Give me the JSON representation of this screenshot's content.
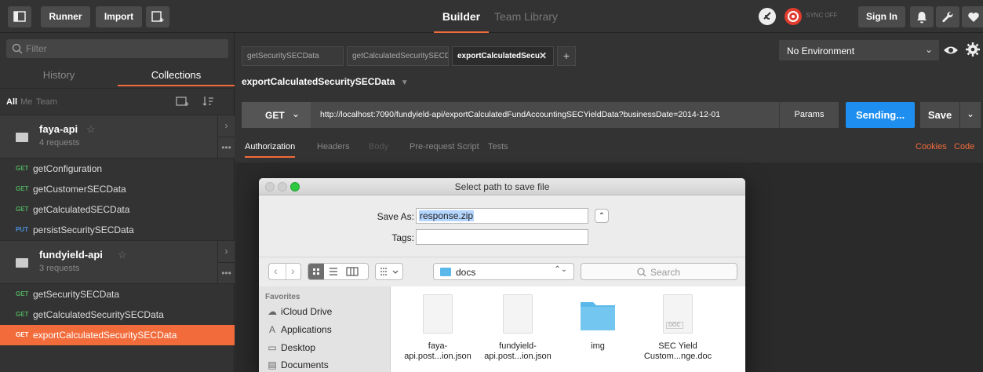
{
  "topbar": {
    "runner_label": "Runner",
    "import_label": "Import",
    "builder_tab": "Builder",
    "team_library_tab": "Team Library",
    "sync_status": "SYNC OFF",
    "signin_label": "Sign In"
  },
  "sidebar": {
    "filter_placeholder": "Filter",
    "history_tab": "History",
    "collections_tab": "Collections",
    "owner_all": "All",
    "owner_me": "Me",
    "owner_team": "Team",
    "collections": [
      {
        "name": "faya-api",
        "count": "4 requests",
        "requests": [
          {
            "method": "GET",
            "name": "getConfiguration"
          },
          {
            "method": "GET",
            "name": "getCustomerSECData"
          },
          {
            "method": "GET",
            "name": "getCalculatedSECData"
          },
          {
            "method": "PUT",
            "name": "persistSecuritySECData"
          }
        ]
      },
      {
        "name": "fundyield-api",
        "count": "3 requests",
        "requests": [
          {
            "method": "GET",
            "name": "getSecuritySECData"
          },
          {
            "method": "GET",
            "name": "getCalculatedSecuritySECData"
          },
          {
            "method": "GET",
            "name": "exportCalculatedSecuritySECData"
          }
        ]
      }
    ]
  },
  "main": {
    "tabs": [
      {
        "label": "getSecuritySECData"
      },
      {
        "label": "getCalculatedSecuritySECDa"
      },
      {
        "label": "exportCalculatedSecu"
      }
    ],
    "environment": "No Environment",
    "request_name": "exportCalculatedSecuritySECData",
    "method": "GET",
    "url": "http://localhost:7090/fundyield-api/exportCalculatedFundAccountingSECYieldData?businessDate=2014-12-01",
    "params_label": "Params",
    "send_label": "Sending...",
    "save_label": "Save",
    "subtabs": [
      "Authorization",
      "Headers",
      "Body",
      "Pre-request Script",
      "Tests"
    ],
    "cookies_label": "Cookies",
    "code_label": "Code"
  },
  "dialog": {
    "title": "Select path to save file",
    "save_as_label": "Save As:",
    "save_as_value": "response.zip",
    "tags_label": "Tags:",
    "location": "docs",
    "search_placeholder": "Search",
    "favorites_header": "Favorites",
    "favorites": [
      {
        "label": "iCloud Drive",
        "icon": "cloud-icon"
      },
      {
        "label": "Applications",
        "icon": "applications-icon"
      },
      {
        "label": "Desktop",
        "icon": "desktop-icon"
      },
      {
        "label": "Documents",
        "icon": "documents-icon"
      }
    ],
    "files": [
      {
        "line1": "faya-",
        "line2": "api.post...ion.json",
        "kind": "document"
      },
      {
        "line1": "fundyield-",
        "line2": "api.post...ion.json",
        "kind": "document"
      },
      {
        "line1": "img",
        "line2": "",
        "kind": "folder"
      },
      {
        "line1": "SEC Yield",
        "line2": "Custom...nge.doc",
        "kind": "doc"
      }
    ],
    "doc_badge": "DOC"
  },
  "colors": {
    "accent_orange": "#f26b3a",
    "send_blue": "#1e8ff0",
    "get_green": "#4fae5e",
    "put_blue": "#4a8fd8",
    "folder_blue": "#5bb8ea"
  }
}
